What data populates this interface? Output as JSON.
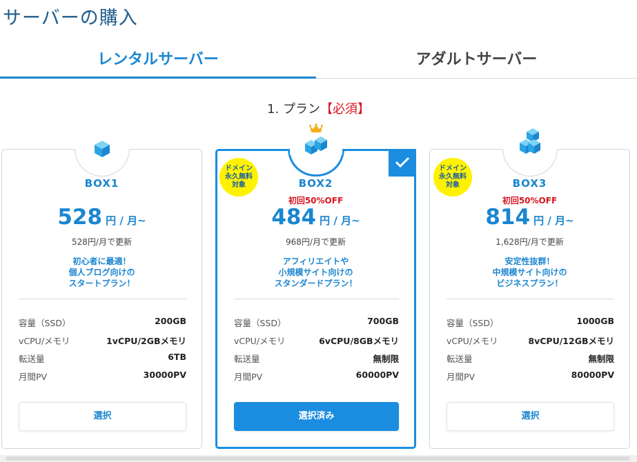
{
  "page": {
    "title": "サーバーの購入"
  },
  "tabs": [
    {
      "label": "レンタルサーバー",
      "active": true
    },
    {
      "label": "アダルトサーバー",
      "active": false
    }
  ],
  "plan_section": {
    "heading": "1. プラン",
    "required": "【必須】"
  },
  "plans": [
    {
      "name": "BOX1",
      "discount": "",
      "price": "528",
      "price_unit": "円 / 月~",
      "renewal": "528円/月で更新",
      "catch_lines": [
        "初心者に最適！",
        "個人ブログ向けの",
        "スタートプラン！"
      ],
      "badge_lines": [],
      "specs": [
        {
          "label": "容量（SSD）",
          "value": "200GB"
        },
        {
          "label": "vCPU/メモリ",
          "value": "1vCPU/2GBメモリ"
        },
        {
          "label": "転送量",
          "value": "6TB"
        },
        {
          "label": "月間PV",
          "value": "30000PV"
        }
      ],
      "button": "選択",
      "selected": false,
      "icon": "single-cube-icon"
    },
    {
      "name": "BOX2",
      "discount": "初回50%OFF",
      "price": "484",
      "price_unit": "円 / 月~",
      "renewal": "968円/月で更新",
      "catch_lines": [
        "アフィリエイトや",
        "小規模サイト向けの",
        "スタンダードプラン！"
      ],
      "badge_lines": [
        "ドメイン",
        "永久無料",
        "対象"
      ],
      "specs": [
        {
          "label": "容量（SSD）",
          "value": "700GB"
        },
        {
          "label": "vCPU/メモリ",
          "value": "6vCPU/8GBメモリ"
        },
        {
          "label": "転送量",
          "value": "無制限"
        },
        {
          "label": "月間PV",
          "value": "60000PV"
        }
      ],
      "button": "選択済み",
      "selected": true,
      "icon": "two-cubes-icon"
    },
    {
      "name": "BOX3",
      "discount": "初回50%OFF",
      "price": "814",
      "price_unit": "円 / 月~",
      "renewal": "1,628円/月で更新",
      "catch_lines": [
        "安定性抜群！",
        "中規模サイト向けの",
        "ビジネスプラン！"
      ],
      "badge_lines": [
        "ドメイン",
        "永久無料",
        "対象"
      ],
      "specs": [
        {
          "label": "容量（SSD）",
          "value": "1000GB"
        },
        {
          "label": "vCPU/メモリ",
          "value": "8vCPU/12GBメモリ"
        },
        {
          "label": "転送量",
          "value": "無制限"
        },
        {
          "label": "月間PV",
          "value": "80000PV"
        }
      ],
      "button": "選択",
      "selected": false,
      "icon": "three-cubes-icon"
    }
  ],
  "colors": {
    "accent": "#1b86d0",
    "selected_border": "#1b8de0",
    "required": "#d8141f",
    "badge": "#fff200",
    "crown": "#f2b01e"
  }
}
